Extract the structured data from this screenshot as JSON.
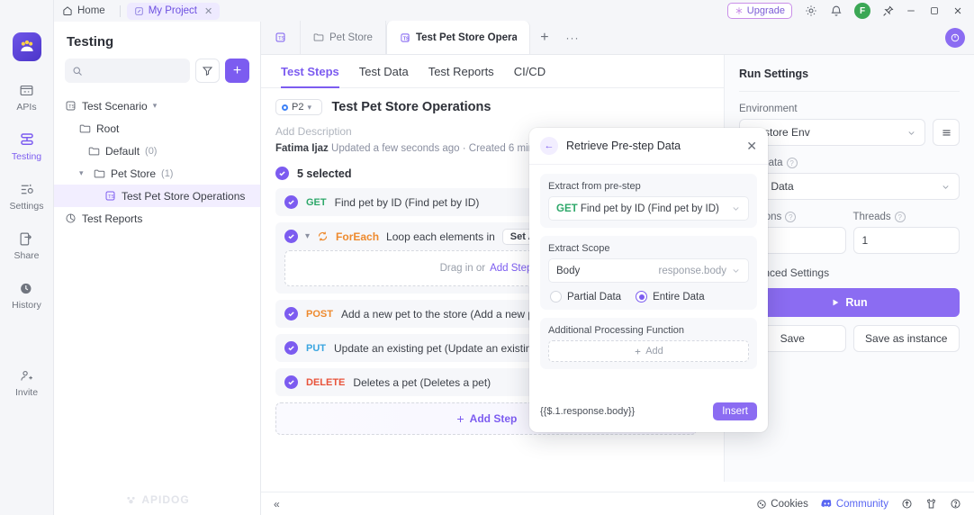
{
  "titlebar": {
    "home_label": "Home",
    "project_label": "My Project",
    "project_close": "✕",
    "upgrade_label": "Upgrade",
    "avatar_initial": "F",
    "minimize": "─",
    "maximize": "☐",
    "close": "✕"
  },
  "rail": {
    "items": [
      {
        "label": "APIs",
        "icon": "apis-icon",
        "active": false
      },
      {
        "label": "Testing",
        "icon": "testing-icon",
        "active": true
      },
      {
        "label": "Settings",
        "icon": "settings-icon",
        "active": false
      },
      {
        "label": "Share",
        "icon": "share-icon",
        "active": false
      },
      {
        "label": "History",
        "icon": "history-icon",
        "active": false
      },
      {
        "label": "Invite",
        "icon": "invite-icon",
        "active": false
      }
    ]
  },
  "sidebar": {
    "title": "Testing",
    "search_placeholder": "",
    "search_value": "",
    "add_label": "+",
    "tree": {
      "root_label": "Test Scenario",
      "nodes": [
        {
          "label": "Root",
          "count": ""
        },
        {
          "label": "Default",
          "count": "(0)"
        },
        {
          "label": "Pet Store",
          "count": "(1)"
        },
        {
          "label": "Test Pet Store Operations",
          "count": ""
        },
        {
          "label": "Test Reports",
          "count": ""
        }
      ]
    },
    "watermark": "APIDOG"
  },
  "tabs": {
    "items": [
      {
        "label": "Pet Store",
        "icon": "folder-icon",
        "active": false
      },
      {
        "label": "Test Pet Store Operatio",
        "icon": "scenario-icon",
        "active": true
      }
    ],
    "plus": "+",
    "more": "···"
  },
  "subtabs": {
    "items": [
      {
        "label": "Test Steps",
        "active": true
      },
      {
        "label": "Test Data",
        "active": false
      },
      {
        "label": "Test Reports",
        "active": false
      },
      {
        "label": "CI/CD",
        "active": false
      }
    ],
    "more": "···"
  },
  "doc": {
    "priority": "P2",
    "title": "Test Pet Store Operations",
    "description_placeholder": "Add Description",
    "author": "Fatima Ijaz",
    "meta": " Updated a few seconds ago · Created 6 minutes ago",
    "selected_label": "5 selected",
    "add_step_label": "Add Step",
    "steps": [
      {
        "type": "request",
        "method": "GET",
        "method_class": "m-get",
        "name": "Find pet by ID (Find pet by ID)"
      },
      {
        "type": "loop",
        "kind": "ForEach",
        "text": "Loop each elements in",
        "chip": "Set Array",
        "drop_text": "Drag in or",
        "drop_link": "Add Step"
      },
      {
        "type": "request",
        "method": "POST",
        "method_class": "m-post",
        "name": "Add a new pet to the store (Add a new pet to the store)"
      },
      {
        "type": "request",
        "method": "PUT",
        "method_class": "m-put",
        "name": "Update an existing pet (Update an existing pet)"
      },
      {
        "type": "request",
        "method": "DELETE",
        "method_class": "m-delete",
        "name": "Deletes a pet (Deletes a pet)"
      }
    ]
  },
  "run_settings": {
    "title": "Run Settings",
    "environment_label": "Environment",
    "environment_value": "Petstore Env",
    "test_data_label": "Test Data",
    "test_data_value": "Test Data",
    "iterations_label": "Iterations",
    "iterations_value": "",
    "threads_label": "Threads",
    "threads_value": "1",
    "advanced_label": "Advanced Settings",
    "run_label": "Run",
    "save_label": "Save",
    "save_instance_label": "Save as instance"
  },
  "popup": {
    "title": "Retrieve Pre-step Data",
    "back": "←",
    "close": "✕",
    "extract_from_label": "Extract from pre-step",
    "extract_from_method": "GET",
    "extract_from_value": "Find pet by ID (Find pet by ID)",
    "extract_scope_label": "Extract Scope",
    "scope_value": "Body",
    "scope_hint": "response.body",
    "radio_partial": "Partial Data",
    "radio_entire": "Entire Data",
    "radio_selected": "Entire Data",
    "processing_label": "Additional Processing Function",
    "add_label": "Add",
    "expression": "{{$.1.response.body}}",
    "insert_label": "Insert"
  },
  "bottombar": {
    "collapse": "«",
    "cookies": "Cookies",
    "community": "Community",
    "upload_icon": "upload-icon",
    "shirt_icon": "shirt-icon",
    "help_icon": "help-icon"
  },
  "colors": {
    "accent": "#7c5cf0",
    "get": "#2ea86a",
    "post": "#ee8a2e",
    "put": "#3aa5e0",
    "delete": "#e8533a",
    "avatar": "#3ba755",
    "discord": "#5865f2"
  }
}
